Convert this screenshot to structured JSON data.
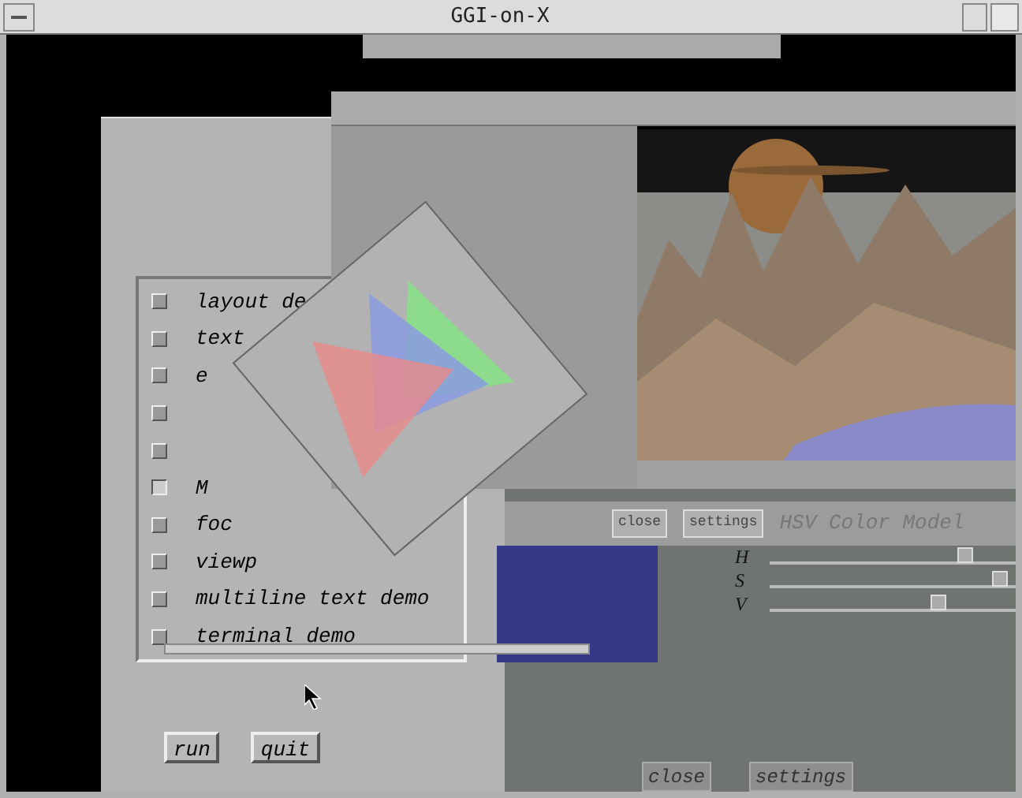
{
  "window": {
    "title": "GGI-on-X"
  },
  "demo_list": [
    {
      "label": "layout de",
      "checked": false
    },
    {
      "label": "text",
      "checked": false
    },
    {
      "label": "e",
      "checked": false
    },
    {
      "checked": false
    },
    {
      "checked": false
    },
    {
      "label": "M",
      "checked": true
    },
    {
      "label": "foc",
      "checked": false
    },
    {
      "label": "viewp",
      "checked": false
    },
    {
      "label": "multiline text demo",
      "checked": false
    },
    {
      "label": "terminal demo",
      "checked": false
    }
  ],
  "main_buttons": [
    "run",
    "quit"
  ],
  "image_window": {
    "buttons": [
      "close",
      "settings"
    ],
    "title": "HSV Color Model"
  },
  "hsv_sliders": [
    {
      "label": "H",
      "level": 0.83
    },
    {
      "label": "S",
      "level": 0.97
    },
    {
      "label": "V",
      "level": 0.72
    }
  ],
  "footer_buttons": [
    "close",
    "settings"
  ]
}
